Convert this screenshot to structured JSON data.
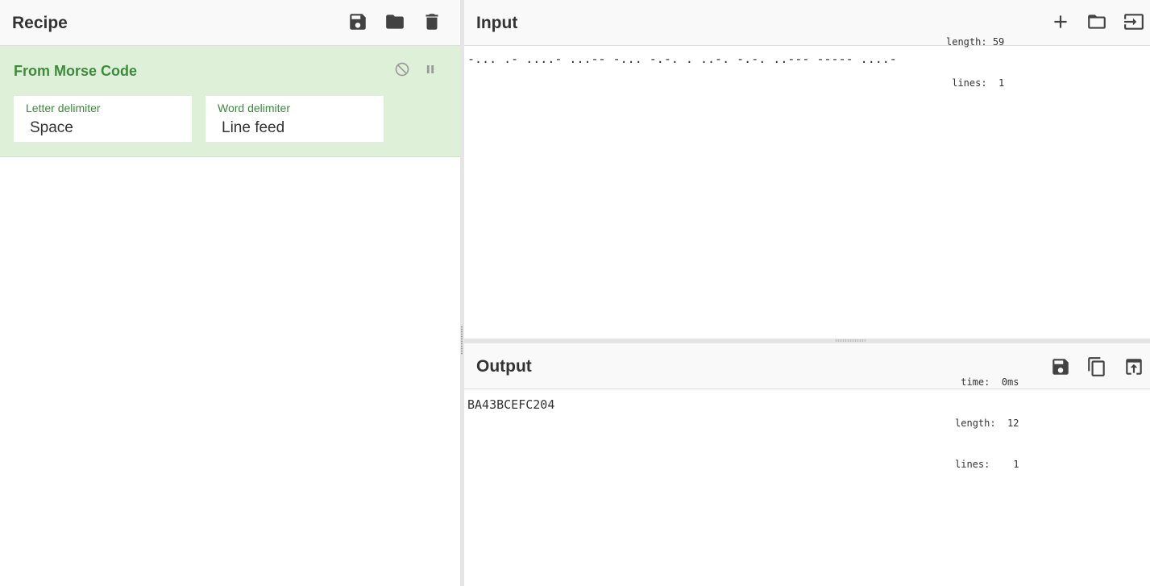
{
  "recipe": {
    "title": "Recipe",
    "icons": [
      "save-icon",
      "folder-icon",
      "trash-icon"
    ],
    "operation": {
      "name": "From Morse Code",
      "controls": [
        "disable-icon",
        "breakpoint-icon"
      ],
      "args": [
        {
          "label": "Letter delimiter",
          "value": "Space"
        },
        {
          "label": "Word delimiter",
          "value": "Line feed"
        }
      ]
    }
  },
  "input": {
    "title": "Input",
    "stats": {
      "length_label": "length:",
      "length": "59",
      "lines_label": "lines:",
      "lines": "1"
    },
    "icons": [
      "plus-icon",
      "folder-icon",
      "load-icon"
    ],
    "text": "-... .- ....- ...-- -... -.-. . ..-. -.-. ..--- ----- ....-"
  },
  "output": {
    "title": "Output",
    "stats": {
      "time_label": "time:",
      "time": "0ms",
      "length_label": "length:",
      "length": "12",
      "lines_label": "lines:",
      "lines": "1"
    },
    "icons": [
      "save-icon",
      "copy-icon",
      "replace-input-icon"
    ],
    "text": "BA43BCEFC204"
  },
  "colors": {
    "accent_green": "#3c8b3c",
    "operation_bg": "#dff0d8",
    "header_bg": "#f9f9f9"
  }
}
